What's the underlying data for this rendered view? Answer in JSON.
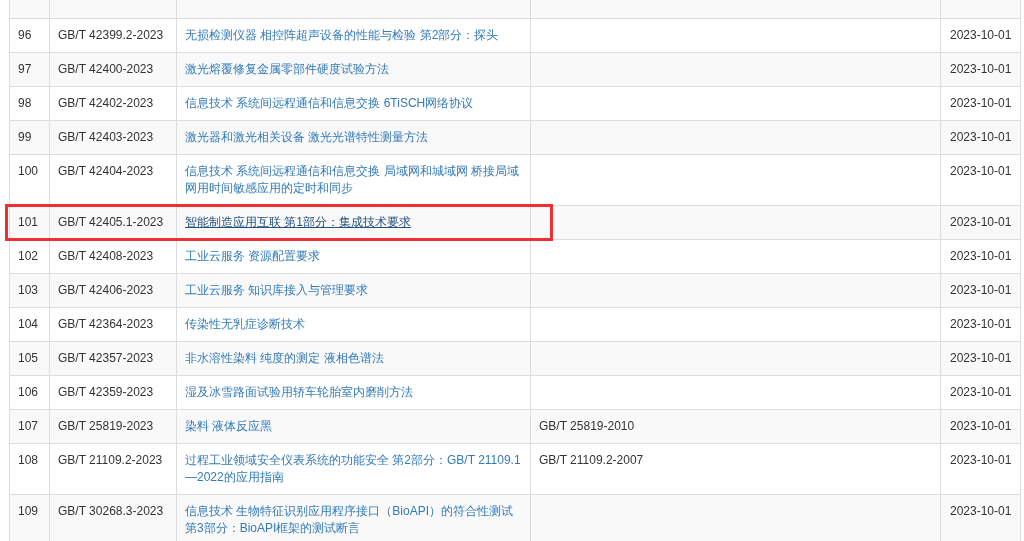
{
  "table": {
    "rows": [
      {
        "number": "96",
        "standard": "GB/T 42399.2-2023",
        "title": "无损检测仪器 相控阵超声设备的性能与检验 第2部分：探头",
        "date": "2023-10-01",
        "highlighted": false
      },
      {
        "number": "97",
        "standard": "GB/T 42400-2023",
        "title": "激光熔覆修复金属零部件硬度试验方法",
        "date": "2023-10-01",
        "highlighted": false
      },
      {
        "number": "98",
        "standard": "GB/T 42402-2023",
        "title": "信息技术 系统间远程通信和信息交换 6TiSCH网络协议",
        "date": "2023-10-01",
        "highlighted": false
      },
      {
        "number": "99",
        "standard": "GB/T 42403-2023",
        "title": "激光器和激光相关设备 激光光谱特性测量方法",
        "date": "2023-10-01",
        "highlighted": false
      },
      {
        "number": "100",
        "standard": "GB/T 42404-2023",
        "title": "信息技术 系统间远程通信和信息交换 局域网和城域网 桥接局域网用时间敏感应用的定时和同步",
        "date": "2023-10-01",
        "highlighted": false
      },
      {
        "number": "101",
        "standard": "GB/T 42405.1-2023",
        "title": "智能制造应用互联 第1部分：集成技术要求",
        "date": "2023-10-01",
        "highlighted": true
      },
      {
        "number": "102",
        "standard": "GB/T 42408-2023",
        "title": "工业云服务 资源配置要求",
        "date": "2023-10-01",
        "highlighted": false
      },
      {
        "number": "103",
        "standard": "GB/T 42406-2023",
        "title": "工业云服务 知识库接入与管理要求",
        "date": "2023-10-01",
        "highlighted": false
      },
      {
        "number": "104",
        "standard": "GB/T 42364-2023",
        "title": "传染性无乳症诊断技术",
        "date": "2023-10-01",
        "highlighted": false
      },
      {
        "number": "105",
        "standard": "GB/T 42357-2023",
        "title": "非水溶性染料 纯度的测定 液相色谱法",
        "date": "2023-10-01",
        "highlighted": false
      },
      {
        "number": "106",
        "standard": "GB/T 42359-2023",
        "title": "湿及冰雪路面试验用轿车轮胎室内磨削方法",
        "date": "2023-10-01",
        "highlighted": false
      },
      {
        "number": "107",
        "standard": "GB/T 25819-2023",
        "title": "染料 液体反应黑",
        "replaces": "GB/T 25819-2010",
        "date": "2023-10-01",
        "highlighted": false
      },
      {
        "number": "108",
        "standard": "GB/T 21109.2-2023",
        "title": "过程工业领域安全仪表系统的功能安全 第2部分：GB/T 21109.1—2022的应用指南",
        "replaces": "GB/T 21109.2-2007",
        "date": "2023-10-01",
        "highlighted": false
      },
      {
        "number": "109",
        "standard": "GB/T 30268.3-2023",
        "title": "信息技术 生物特征识别应用程序接口（BioAPI）的符合性测试第3部分：BioAPI框架的测试断言",
        "date": "2023-10-01",
        "highlighted": false
      }
    ]
  }
}
